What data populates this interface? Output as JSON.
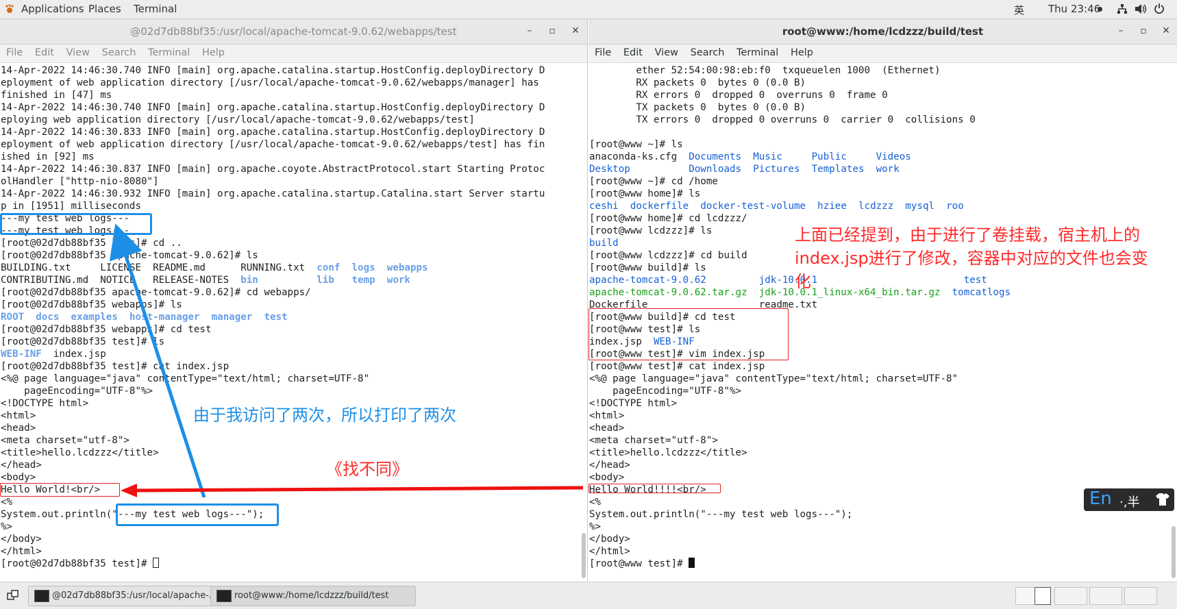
{
  "topbar": {
    "applications": "Applications",
    "places": "Places",
    "terminal": "Terminal",
    "input_method": "英",
    "clock": "Thu 23:46",
    "network_icon": "network-icon",
    "volume_icon": "volume-icon",
    "power_icon": "power-icon"
  },
  "left_window": {
    "title": "@02d7db88bf35:/usr/local/apache-tomcat-9.0.62/webapps/test",
    "menu": [
      "File",
      "Edit",
      "View",
      "Search",
      "Terminal",
      "Help"
    ],
    "lines": [
      "14-Apr-2022 14:46:30.740 INFO [main] org.apache.catalina.startup.HostConfig.deployDirectory D",
      "eployment of web application directory [/usr/local/apache-tomcat-9.0.62/webapps/manager] has",
      "finished in [47] ms",
      "14-Apr-2022 14:46:30.740 INFO [main] org.apache.catalina.startup.HostConfig.deployDirectory D",
      "eploying web application directory [/usr/local/apache-tomcat-9.0.62/webapps/test]",
      "14-Apr-2022 14:46:30.833 INFO [main] org.apache.catalina.startup.HostConfig.deployDirectory D",
      "eployment of web application directory [/usr/local/apache-tomcat-9.0.62/webapps/test] has fin",
      "ished in [92] ms",
      "14-Apr-2022 14:46:30.837 INFO [main] org.apache.coyote.AbstractProtocol.start Starting Protoc",
      "olHandler [\"http-nio-8080\"]",
      "14-Apr-2022 14:46:30.932 INFO [main] org.apache.catalina.startup.Catalina.start Server startu",
      "p in [1951] milliseconds",
      "---my test web logs---",
      "---my test web logs---",
      "[root@02d7db88bf35 logs]# cd ..",
      "[root@02d7db88bf35 apache-tomcat-9.0.62]# ls",
      "[[BUILDING.txt     LICENSE  README.md      RUNNING.txt  ]]{conf}[[  ]]{logs}[[  ]]{webapps}",
      "[[CONTRIBUTING.md  NOTICE   RELEASE-NOTES  ]]{bin}[[          ]]{lib}[[   ]]{temp}[[  ]]{work}",
      "[root@02d7db88bf35 apache-tomcat-9.0.62]# cd webapps/",
      "[root@02d7db88bf35 webapps]# ls",
      "{ROOT}[[  ]]{docs}[[  ]]{examples}[[  ]]{host-manager}[[  ]]{manager}[[  ]]{test}",
      "[root@02d7db88bf35 webapps]# cd test",
      "[root@02d7db88bf35 test]# ls",
      "{WEB-INF}[[  index.jsp]]",
      "[root@02d7db88bf35 test]# cat index.jsp",
      "<%@ page language=\"java\" contentType=\"text/html; charset=UTF-8\"",
      "    pageEncoding=\"UTF-8\"%>",
      "<!DOCTYPE html>",
      "<html>",
      "<head>",
      "<meta charset=\"utf-8\">",
      "<title>hello.lcdzzz</title>",
      "</head>",
      "<body>",
      "Hello World!<br/>",
      "<%",
      "System.out.println(\"---my test web logs---\");",
      "%>",
      "</body>",
      "</html>",
      "[root@02d7db88bf35 test]# "
    ]
  },
  "right_window": {
    "title": "root@www:/home/lcdzzz/build/test",
    "menu": [
      "File",
      "Edit",
      "View",
      "Search",
      "Terminal",
      "Help"
    ],
    "lines": [
      "        ether 52:54:00:98:eb:f0  txqueuelen 1000  (Ethernet)",
      "        RX packets 0  bytes 0 (0.0 B)",
      "        RX errors 0  dropped 0  overruns 0  frame 0",
      "        TX packets 0  bytes 0 (0.0 B)",
      "        TX errors 0  dropped 0 overruns 0  carrier 0  collisions 0",
      "",
      "[root@www ~]# ls",
      "[[anaconda-ks.cfg  ]]{Documents}[[  ]]{Music}[[     ]]{Public}[[     ]]{Videos}",
      "{Desktop}[[          ]]{Downloads}[[  ]]{Pictures}[[  ]]{Templates}[[  ]]{work}",
      "[root@www ~]# cd /home",
      "[root@www home]# ls",
      "{ceshi}[[  ]]{dockerfile}[[  ]]{docker-test-volume}[[  ]]{hziee}[[  ]]{lcdzzz}[[  ]]{mysql}[[  ]]{roo}",
      "[root@www home]# cd lcdzzz/",
      "[root@www lcdzzz]# ls",
      "{build}",
      "[root@www lcdzzz]# cd build",
      "[root@www build]# ls",
      "{apache-tomcat-9.0.62}[[         ]]{jdk-10.0.1}[[                         ]]{test}",
      "<apache-tomcat-9.0.62.tar.gz>[[  ]]<jdk-10.0.1_linux-x64_bin.tar.gz>[[  ]]{tomcatlogs}",
      "Dockerfile                   readme.txt",
      "[root@www build]# cd test",
      "[root@www test]# ls",
      "[[index.jsp  ]]{WEB-INF}",
      "[root@www test]# vim index.jsp",
      "[root@www test]# cat index.jsp",
      "<%@ page language=\"java\" contentType=\"text/html; charset=UTF-8\"",
      "    pageEncoding=\"UTF-8\"%>",
      "<!DOCTYPE html>",
      "<html>",
      "<head>",
      "<meta charset=\"utf-8\">",
      "<title>hello.lcdzzz</title>",
      "</head>",
      "<body>",
      "Hello World!!!!<br/>",
      "<%",
      "System.out.println(\"---my test web logs---\");",
      "%>",
      "</body>",
      "</html>",
      "[root@www test]# "
    ]
  },
  "annotations": {
    "blue_note": "由于我访问了两次，所以打印了两次",
    "red_diff": "《找不同》",
    "red_note": "上面已经提到，由于进行了卷挂载，宿主机上的index.jsp进行了修改，容器中对应的文件也会变化"
  },
  "ime": {
    "mode": "En",
    "rest": "·,半"
  },
  "taskbar": {
    "task1": "@02d7db88bf35:/usr/local/apache-...",
    "task2": "root@www:/home/lcdzzz/build/test"
  }
}
